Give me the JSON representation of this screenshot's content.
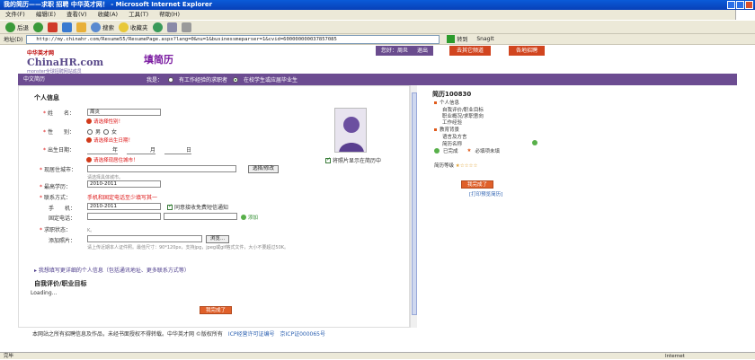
{
  "window": {
    "title": "我的简历——求职 招聘 中华英才网！ - Microsoft Internet Explorer"
  },
  "menu": [
    "文件(F)",
    "编辑(E)",
    "查看(V)",
    "收藏(A)",
    "工具(T)",
    "帮助(H)"
  ],
  "toolbar": {
    "back": "后退",
    "search": "搜索",
    "favorites": "收藏夹"
  },
  "address": {
    "label": "地址(D)",
    "url": "http://my.chinahr.com/Resume55/ResumePage.aspx?lang=0&nu=1&businessmeparser=1&cvid=600000000037857085",
    "go": "转到",
    "links": "SnagIt"
  },
  "site": {
    "logo_cn": "中华英才网",
    "logo_en": "ChinaHR.com",
    "logo_sub": "monster全球招聘网站成员",
    "page_title": "填简历",
    "user_greeting": "您好：周炎",
    "logout": "退出",
    "nav_resume_center": "去其它频道",
    "nav_jobs": "各地招聘"
  },
  "tabs": {
    "active": "中文简历",
    "iam_label": "我是：",
    "opt_experienced": "有工作经验的求职者",
    "opt_student": "在校学生或应届毕业生"
  },
  "form": {
    "section_personal": "个人信息",
    "name_label": "姓　　名：",
    "name_value": "周炎",
    "gender_err": "请选择性别！",
    "gender_label": "性　　别：",
    "male": "男",
    "female": "女",
    "birth_err": "请选择出生日期！",
    "birth_label": "出生日期：",
    "year": "年",
    "month": "月",
    "day": "日",
    "city_err": "请选择现居住城市！",
    "city_label": "现居住城市：",
    "city_btn": "选择/修改",
    "city_hint": "请选择具体城市。",
    "edu_label": "最高学历：",
    "edu_value": "2010-2011",
    "contact_label": "联系方式：",
    "contact_note": "手机和固定电话至少填写其一",
    "mobile_label": "手　　机：",
    "mobile_value": "2010-2011",
    "sms_label": "同意接收免费短信通知",
    "phone_label": "固定电话：",
    "add_label": "添加",
    "status_label": "求职状态：",
    "status_hint": "K。",
    "photo_label": "添加照片：",
    "browse_btn": "浏览...",
    "photo_hint": "请上传近期本人证件照。最佳尺寸：90*120px，支持jpg，jpeg或gif格式文件，大小不要超过50K。",
    "photo_show": "将照片显示在简历中",
    "more_link": "我想填写更详细的个人信息（包括通讯地址、更多联系方式等）",
    "section_eval": "自我评价/职业目标",
    "loading": "Loading...",
    "save_btn": "我完成了"
  },
  "right_panel": {
    "title": "简历100830",
    "items": [
      "个人信息",
      "自我评价/职业目标",
      "职业概况/求职意向",
      "工作经验",
      "教育背景",
      "语言及方言",
      "简历名称"
    ],
    "done_label": "已完成",
    "required_label": "必填项未填",
    "grade_label": "简历等级",
    "finish_btn": "我完成了",
    "print_link": "[打印预览简历]"
  },
  "footer": {
    "copyright": "本网站之所有招聘信息及作品，未经书面授权不得转载。中华英才网 ©版权所有",
    "icp1": "ICP经营许可证编号",
    "icp2": "京ICP证000065号"
  },
  "status": {
    "text": "完毕",
    "zone": "Internet"
  },
  "colors": {
    "brand_purple": "#6c4c91",
    "accent_orange": "#e0602a",
    "error_red": "#d11111"
  }
}
